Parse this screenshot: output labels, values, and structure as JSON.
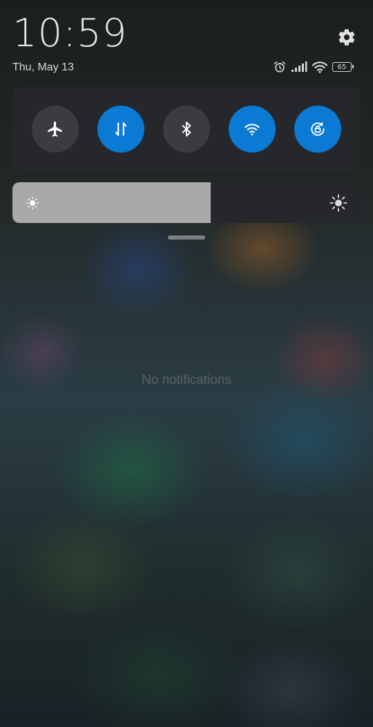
{
  "status": {
    "time": "10:59",
    "date": "Thu, May 13",
    "battery_level": "65"
  },
  "quick_toggles": [
    {
      "name": "airplane-mode",
      "icon": "airplane-icon",
      "active": false
    },
    {
      "name": "mobile-data",
      "icon": "data-transfer-icon",
      "active": true
    },
    {
      "name": "bluetooth",
      "icon": "bluetooth-icon",
      "active": false
    },
    {
      "name": "wifi",
      "icon": "wifi-icon",
      "active": true
    },
    {
      "name": "rotation-lock",
      "icon": "rotation-lock-icon",
      "active": true
    }
  ],
  "brightness": {
    "level": 0.57
  },
  "notifications": {
    "empty_message": "No notifications"
  },
  "colors": {
    "accent": "#0a7ad4",
    "toggle_off": "#3a3c40",
    "panel": "#25272b",
    "brightness_fill": "#a9a9a9"
  }
}
